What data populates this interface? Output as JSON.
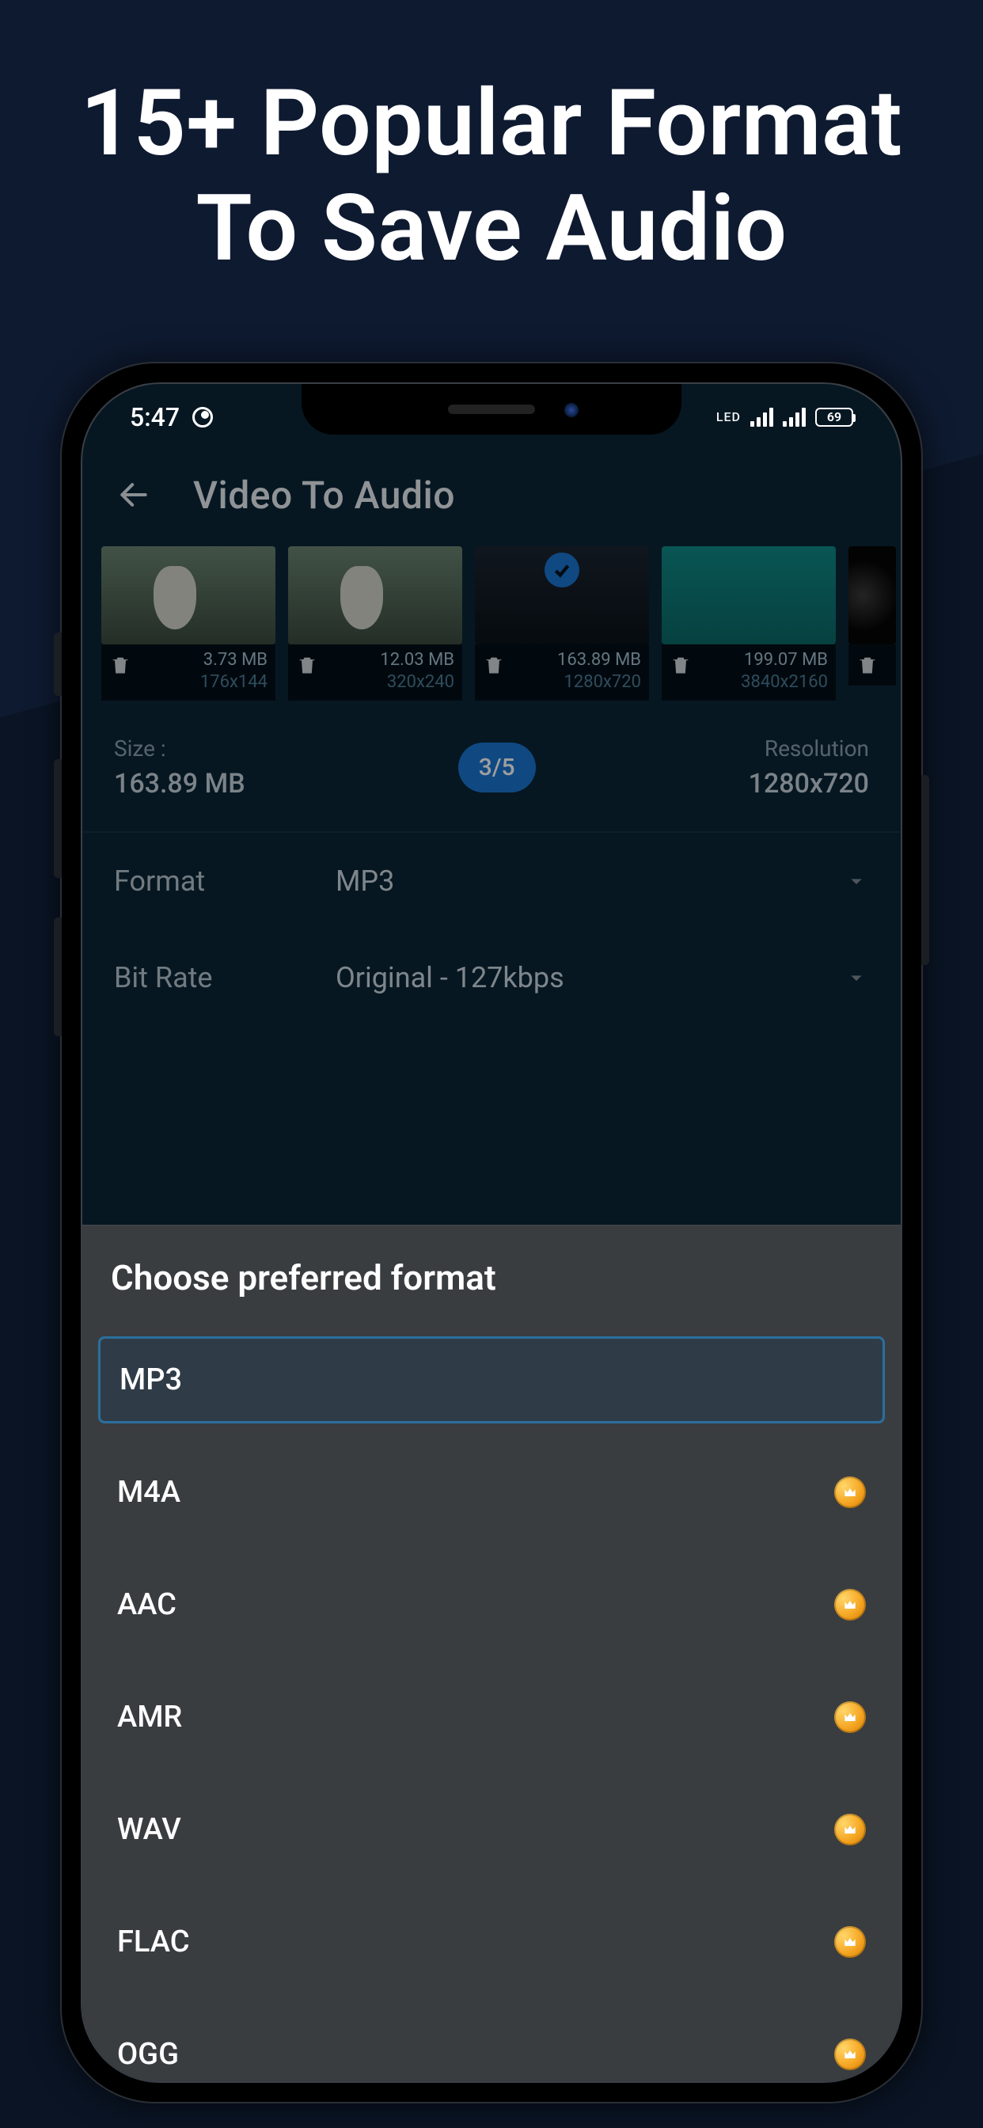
{
  "promo": {
    "headline_line1": "15+ Popular Format",
    "headline_line2": "To Save Audio"
  },
  "status": {
    "time": "5:47",
    "net_label": "LED",
    "battery_pct": "69"
  },
  "appbar": {
    "title": "Video To Audio"
  },
  "thumbs": [
    {
      "size": "3.73 MB",
      "res": "176x144",
      "kind": "forest",
      "selected": false
    },
    {
      "size": "12.03 MB",
      "res": "320x240",
      "kind": "forest",
      "selected": false
    },
    {
      "size": "163.89 MB",
      "res": "1280x720",
      "kind": "dark",
      "selected": true
    },
    {
      "size": "199.07 MB",
      "res": "3840x2160",
      "kind": "ocean",
      "selected": false
    },
    {
      "size": "",
      "res": "",
      "kind": "space",
      "selected": false
    }
  ],
  "info": {
    "size_label": "Size :",
    "size_value": "163.89 MB",
    "pager": "3/5",
    "res_label": "Resolution",
    "res_value": "1280x720"
  },
  "settings": {
    "format_label": "Format",
    "format_value": "MP3",
    "bitrate_label": "Bit Rate",
    "bitrate_value": "Original - 127kbps"
  },
  "sheet": {
    "title": "Choose preferred format",
    "options": [
      {
        "name": "MP3",
        "premium": false,
        "selected": true
      },
      {
        "name": "M4A",
        "premium": true,
        "selected": false
      },
      {
        "name": "AAC",
        "premium": true,
        "selected": false
      },
      {
        "name": "AMR",
        "premium": true,
        "selected": false
      },
      {
        "name": "WAV",
        "premium": true,
        "selected": false
      },
      {
        "name": "FLAC",
        "premium": true,
        "selected": false
      },
      {
        "name": "OGG",
        "premium": true,
        "selected": false
      }
    ]
  }
}
